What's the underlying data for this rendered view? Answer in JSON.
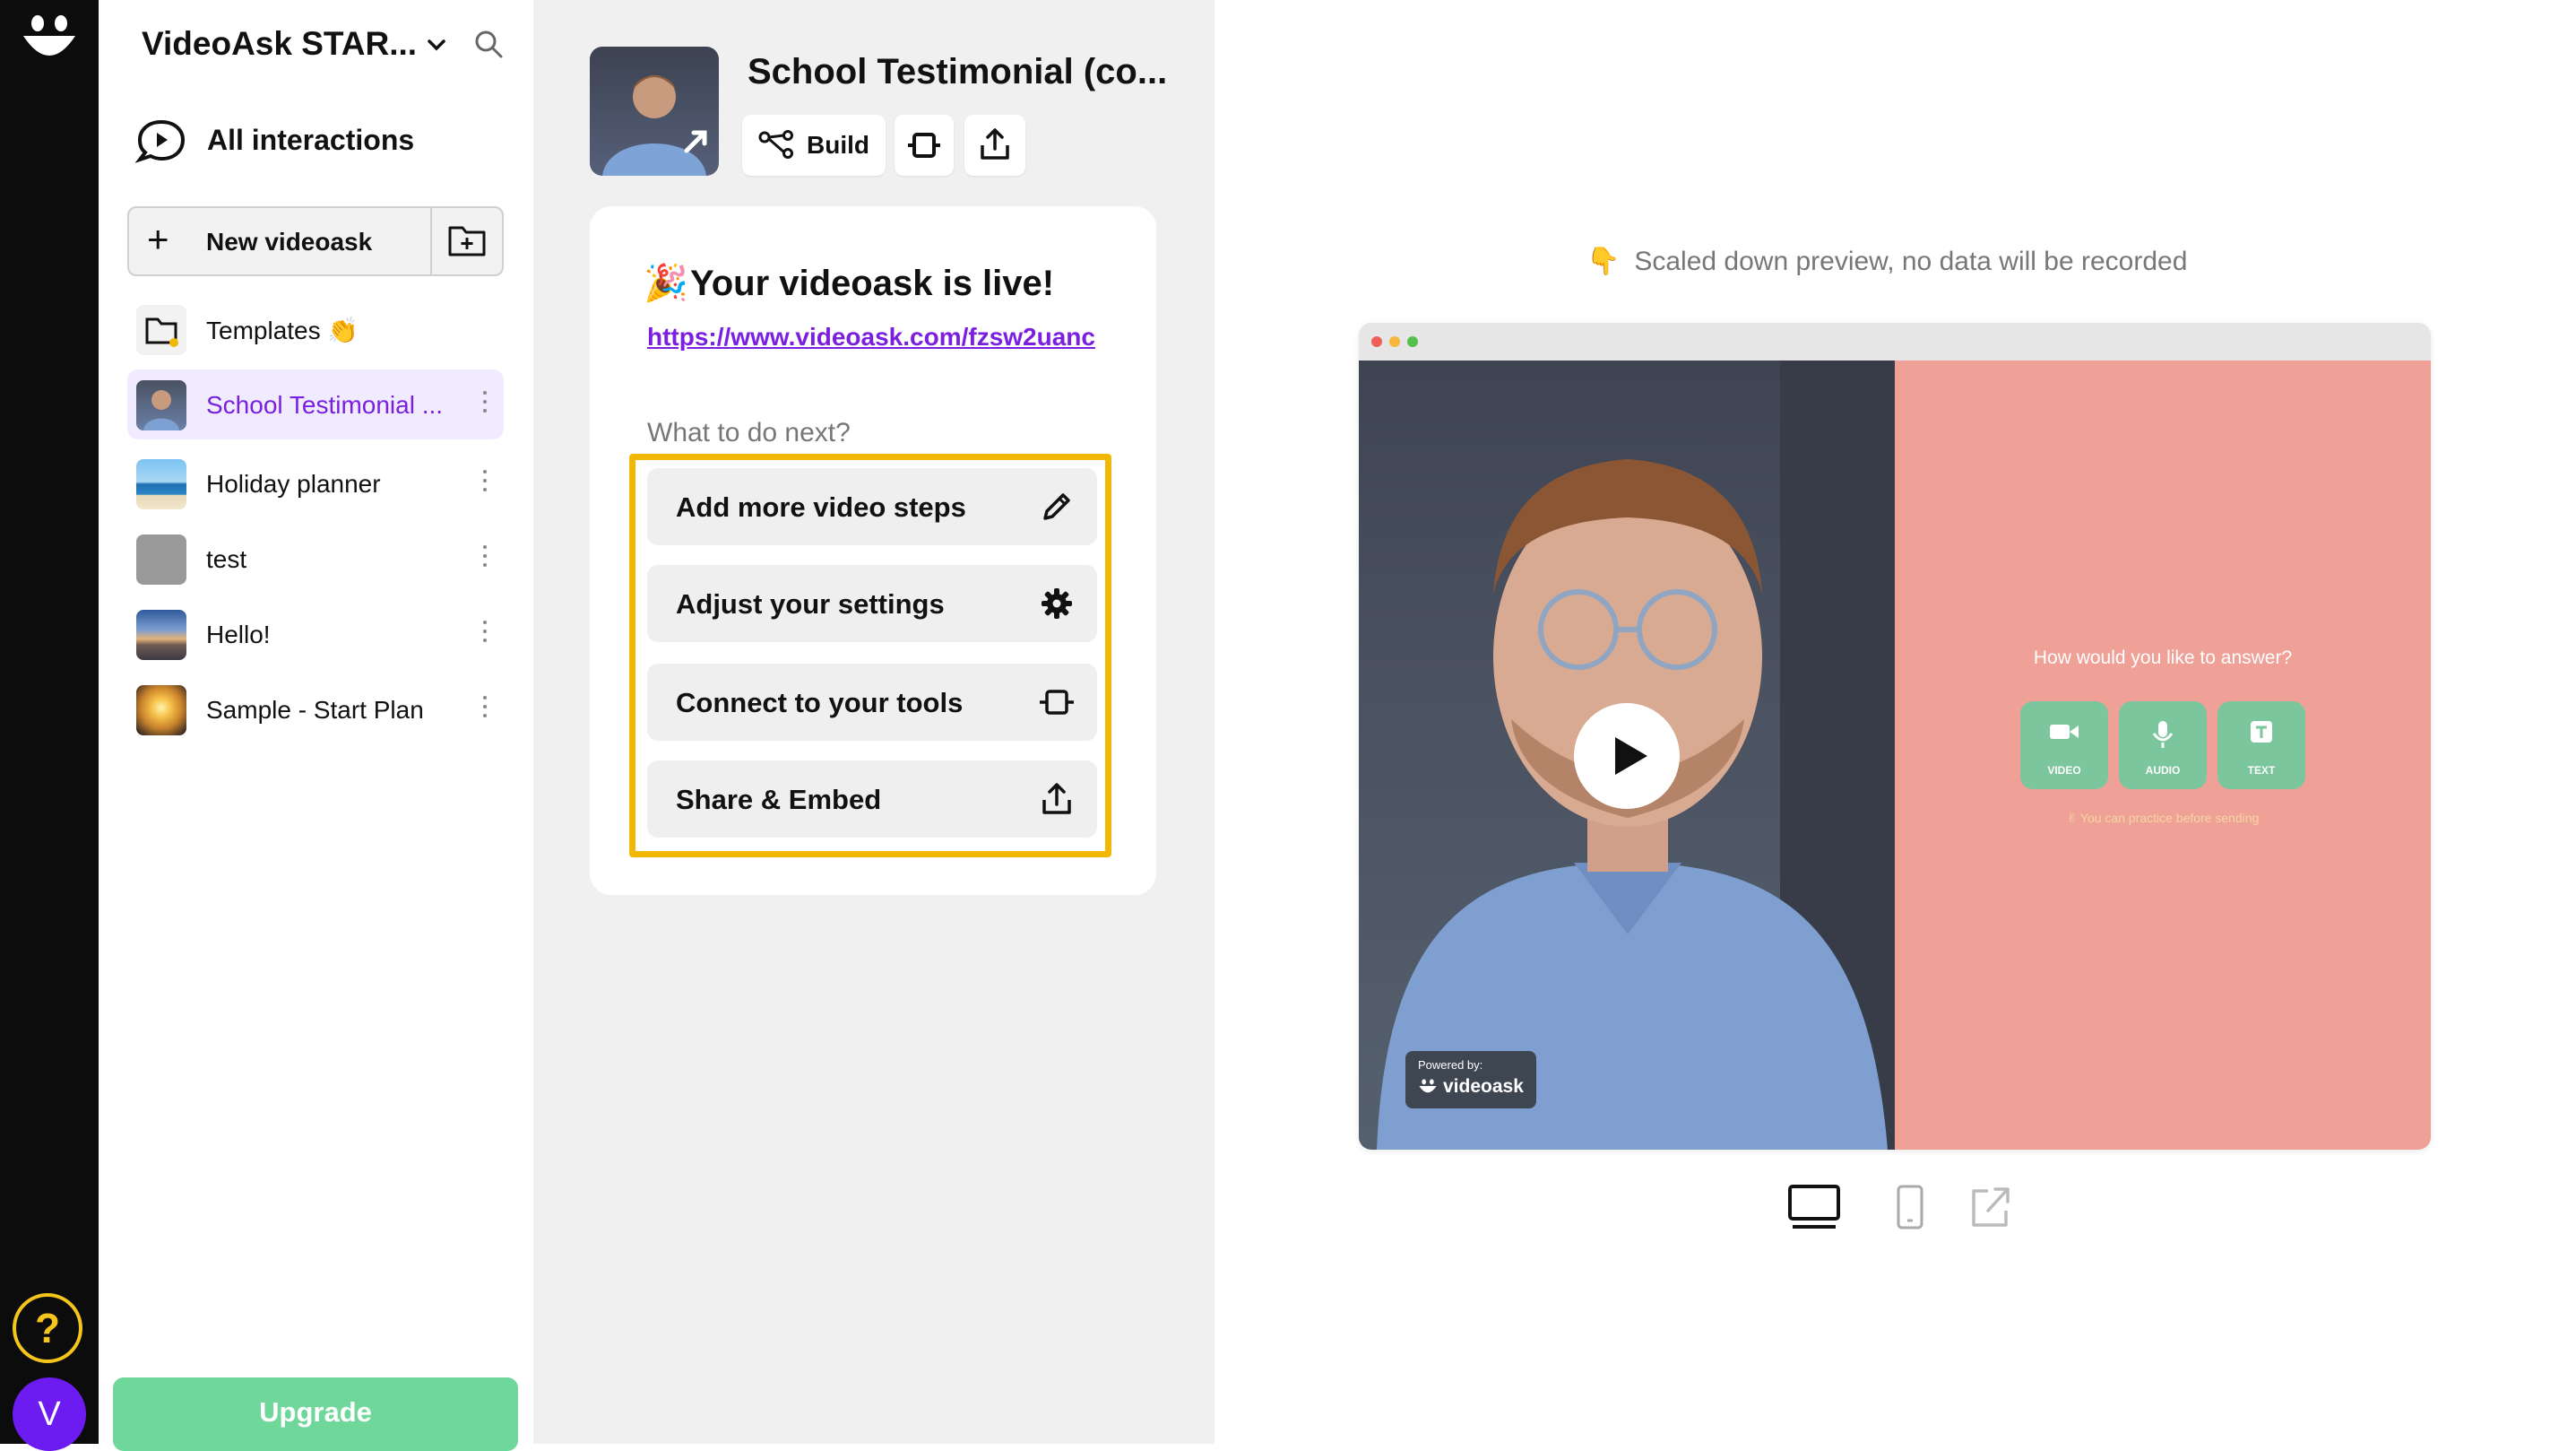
{
  "rail": {
    "help_label": "?",
    "avatar_initial": "V"
  },
  "sidebar": {
    "workspace_title": "VideoAsk STAR...",
    "all_interactions_label": "All interactions",
    "new_videoask_label": "New videoask",
    "items": [
      {
        "label": "Templates 👏",
        "thumb": "folder"
      },
      {
        "label": "School Testimonial ...",
        "thumb": "person",
        "selected": true
      },
      {
        "label": "Holiday planner",
        "thumb": "beach"
      },
      {
        "label": "test",
        "thumb": "gray"
      },
      {
        "label": "Hello!",
        "thumb": "city"
      },
      {
        "label": "Sample - Start Plan",
        "thumb": "sunset"
      }
    ],
    "upgrade_label": "Upgrade"
  },
  "middle": {
    "title": "School Testimonial (co...",
    "build_label": "Build",
    "live_emoji": "🎉",
    "live_title": "Your videoask is live!",
    "live_url": "https://www.videoask.com/fzsw2uanc",
    "next_label": "What to do next?",
    "next_actions": [
      {
        "label": "Add more video steps",
        "icon": "pencil-icon"
      },
      {
        "label": "Adjust your settings",
        "icon": "gear-icon"
      },
      {
        "label": "Connect to your tools",
        "icon": "integration-icon"
      },
      {
        "label": "Share & Embed",
        "icon": "upload-icon"
      }
    ]
  },
  "preview": {
    "hint_emoji": "👇",
    "hint_text": "Scaled down preview, no data will be recorded",
    "question": "How would you like to answer?",
    "answer_options": [
      "VIDEO",
      "AUDIO",
      "TEXT"
    ],
    "practice_note": "✌ You can practice before sending",
    "powered_by": "Powered by:",
    "brand": "videoask"
  },
  "colors": {
    "accent": "#7a1fe0",
    "highlight": "#f2b705",
    "upgrade": "#6fd79a",
    "answer_bg": "#f0a197",
    "answer_btn": "#7bc69d"
  }
}
